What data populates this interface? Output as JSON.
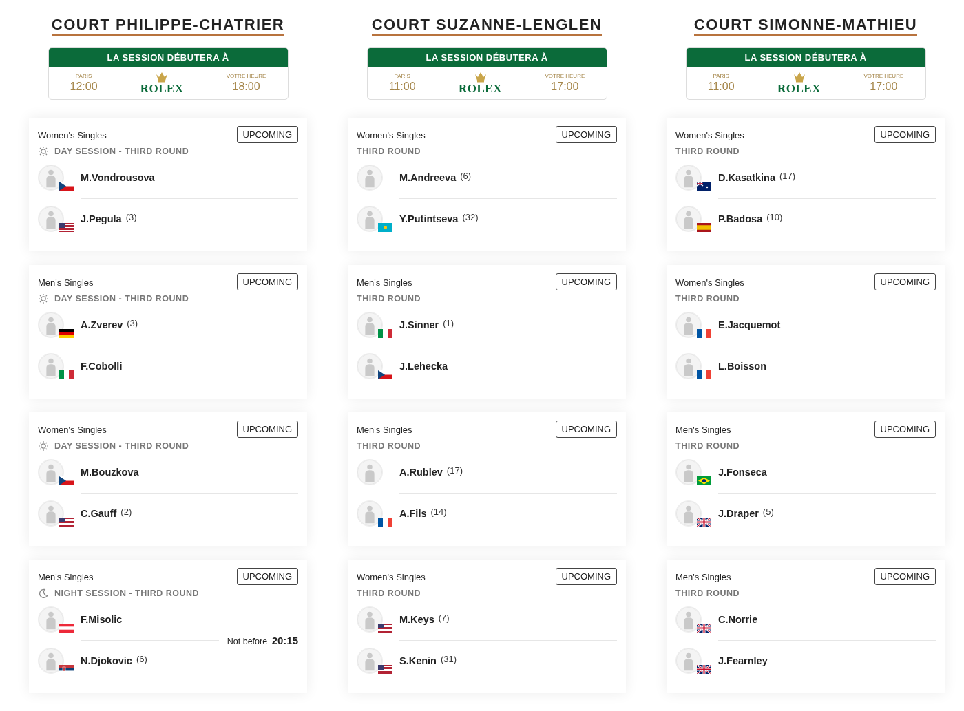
{
  "courts": [
    {
      "title": "COURT PHILIPPE-CHATRIER",
      "session_box": {
        "heading": "LA SESSION DÉBUTERA À",
        "local_label": "PARIS",
        "local_time": "12:00",
        "brand": "ROLEX",
        "your_label": "VOTRE HEURE",
        "your_time": "18:00"
      },
      "matches": [
        {
          "category": "Women's Singles",
          "status": "UPCOMING",
          "session": {
            "kind": "sun"
          },
          "round": "DAY SESSION - THIRD ROUND",
          "players": [
            {
              "name": "M.Vondrousova",
              "flag": {
                "kind": "cz"
              }
            },
            {
              "name": "J.Pegula",
              "seed": "(3)",
              "flag": {
                "kind": "us"
              }
            }
          ]
        },
        {
          "category": "Men's Singles",
          "status": "UPCOMING",
          "session": {
            "kind": "sun"
          },
          "round": "DAY SESSION - THIRD ROUND",
          "players": [
            {
              "name": "A.Zverev",
              "seed": "(3)",
              "flag": {
                "kind": "de"
              }
            },
            {
              "name": "F.Cobolli",
              "flag": {
                "kind": "it"
              }
            }
          ]
        },
        {
          "category": "Women's Singles",
          "status": "UPCOMING",
          "session": {
            "kind": "sun"
          },
          "round": "DAY SESSION - THIRD ROUND",
          "players": [
            {
              "name": "M.Bouzkova",
              "flag": {
                "kind": "cz"
              }
            },
            {
              "name": "C.Gauff",
              "seed": "(2)",
              "flag": {
                "kind": "us"
              }
            }
          ]
        },
        {
          "category": "Men's Singles",
          "status": "UPCOMING",
          "session": {
            "kind": "moon"
          },
          "round": "NIGHT SESSION - THIRD ROUND",
          "not_before": {
            "label": "Not before",
            "time": "20:15"
          },
          "players": [
            {
              "name": "F.Misolic",
              "flag": {
                "kind": "at"
              }
            },
            {
              "name": "N.Djokovic",
              "seed": "(6)",
              "flag": {
                "kind": "rs"
              }
            }
          ]
        }
      ]
    },
    {
      "title": "COURT SUZANNE-LENGLEN",
      "session_box": {
        "heading": "LA SESSION DÉBUTERA À",
        "local_label": "PARIS",
        "local_time": "11:00",
        "brand": "ROLEX",
        "your_label": "VOTRE HEURE",
        "your_time": "17:00"
      },
      "matches": [
        {
          "category": "Women's Singles",
          "status": "UPCOMING",
          "round": "THIRD ROUND",
          "players": [
            {
              "name": "M.Andreeva",
              "seed": "(6)"
            },
            {
              "name": "Y.Putintseva",
              "seed": "(32)",
              "flag": {
                "kind": "kz"
              }
            }
          ]
        },
        {
          "category": "Men's Singles",
          "status": "UPCOMING",
          "round": "THIRD ROUND",
          "players": [
            {
              "name": "J.Sinner",
              "seed": "(1)",
              "flag": {
                "kind": "it"
              }
            },
            {
              "name": "J.Lehecka",
              "flag": {
                "kind": "cz"
              }
            }
          ]
        },
        {
          "category": "Men's Singles",
          "status": "UPCOMING",
          "round": "THIRD ROUND",
          "players": [
            {
              "name": "A.Rublev",
              "seed": "(17)"
            },
            {
              "name": "A.Fils",
              "seed": "(14)",
              "flag": {
                "kind": "fr"
              }
            }
          ]
        },
        {
          "category": "Women's Singles",
          "status": "UPCOMING",
          "round": "THIRD ROUND",
          "players": [
            {
              "name": "M.Keys",
              "seed": "(7)",
              "flag": {
                "kind": "us"
              }
            },
            {
              "name": "S.Kenin",
              "seed": "(31)",
              "flag": {
                "kind": "us"
              }
            }
          ]
        }
      ]
    },
    {
      "title": "COURT SIMONNE-MATHIEU",
      "session_box": {
        "heading": "LA SESSION DÉBUTERA À",
        "local_label": "PARIS",
        "local_time": "11:00",
        "brand": "ROLEX",
        "your_label": "VOTRE HEURE",
        "your_time": "17:00"
      },
      "matches": [
        {
          "category": "Women's Singles",
          "status": "UPCOMING",
          "round": "THIRD ROUND",
          "players": [
            {
              "name": "D.Kasatkina",
              "seed": "(17)",
              "flag": {
                "kind": "au"
              }
            },
            {
              "name": "P.Badosa",
              "seed": "(10)",
              "flag": {
                "kind": "es"
              }
            }
          ]
        },
        {
          "category": "Women's Singles",
          "status": "UPCOMING",
          "round": "THIRD ROUND",
          "players": [
            {
              "name": "E.Jacquemot",
              "flag": {
                "kind": "fr"
              }
            },
            {
              "name": "L.Boisson",
              "flag": {
                "kind": "fr"
              }
            }
          ]
        },
        {
          "category": "Men's Singles",
          "status": "UPCOMING",
          "round": "THIRD ROUND",
          "players": [
            {
              "name": "J.Fonseca",
              "flag": {
                "kind": "br"
              }
            },
            {
              "name": "J.Draper",
              "seed": "(5)",
              "flag": {
                "kind": "gb"
              }
            }
          ]
        },
        {
          "category": "Men's Singles",
          "status": "UPCOMING",
          "round": "THIRD ROUND",
          "players": [
            {
              "name": "C.Norrie",
              "flag": {
                "kind": "gb"
              }
            },
            {
              "name": "J.Fearnley",
              "flag": {
                "kind": "gb"
              }
            }
          ]
        }
      ]
    }
  ]
}
